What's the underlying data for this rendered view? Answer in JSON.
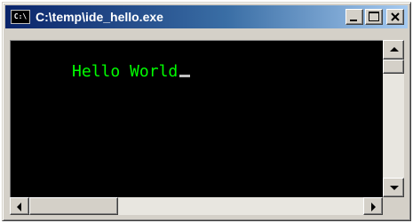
{
  "window": {
    "title": "C:\\temp\\ide_hello.exe",
    "icon_text": "C:\\"
  },
  "console": {
    "output": "Hello World",
    "text_color": "#00ff00",
    "background": "#000000"
  },
  "colors": {
    "titlebar_start": "#0a246a",
    "titlebar_end": "#a6caf0",
    "chrome": "#d4d0c8"
  },
  "icons": {
    "app": "console-icon",
    "minimize": "minimize-icon",
    "maximize": "maximize-icon",
    "close": "close-icon"
  }
}
